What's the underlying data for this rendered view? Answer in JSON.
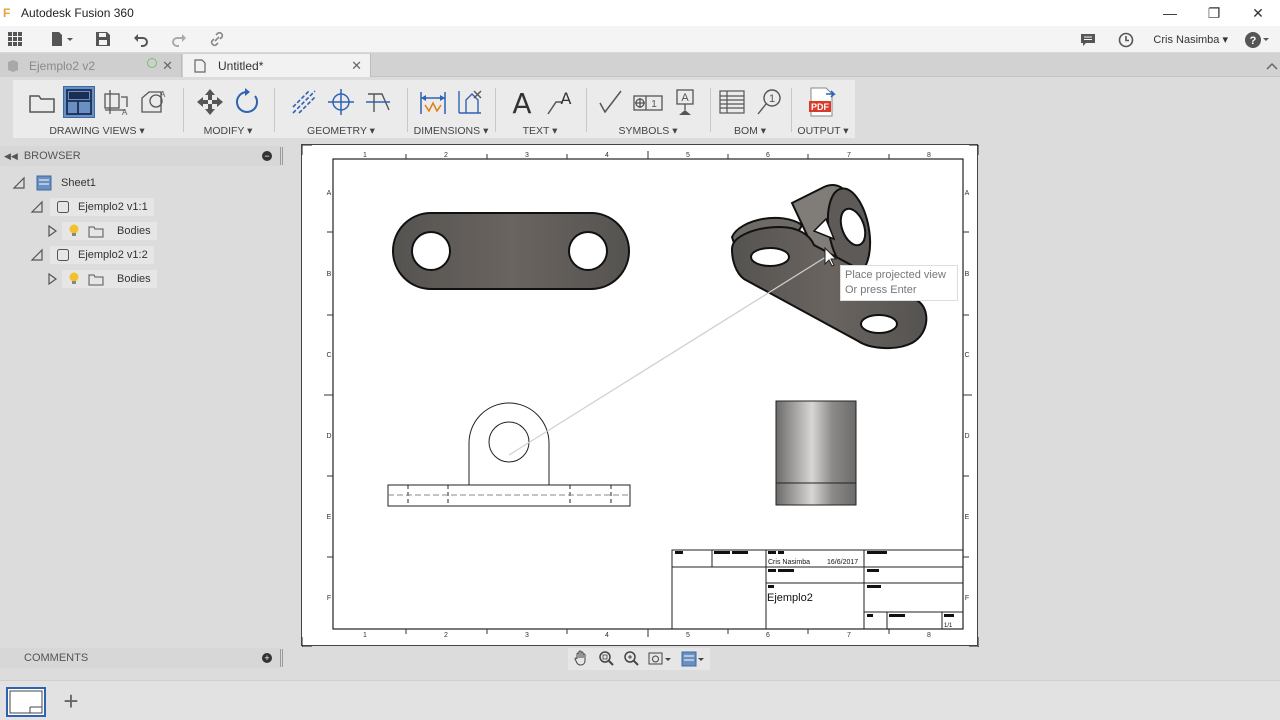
{
  "window": {
    "title": "Autodesk Fusion 360",
    "logo": "F"
  },
  "window_controls": {
    "minimize": "—",
    "restore": "❐",
    "close": "✕"
  },
  "user": {
    "name": "Cris Nasimba ▾"
  },
  "tabs": [
    {
      "label": "Ejemplo2 v2"
    },
    {
      "label": "Untitled*"
    }
  ],
  "ribbon": {
    "groups": [
      {
        "label": "DRAWING VIEWS ▾"
      },
      {
        "label": "MODIFY ▾"
      },
      {
        "label": "GEOMETRY ▾"
      },
      {
        "label": "DIMENSIONS ▾"
      },
      {
        "label": "TEXT ▾"
      },
      {
        "label": "SYMBOLS ▾"
      },
      {
        "label": "BOM ▾"
      },
      {
        "label": "OUTPUT ▾"
      }
    ],
    "pdf_label": "PDF"
  },
  "browser": {
    "header": "BROWSER",
    "items": [
      {
        "label": "Sheet1"
      },
      {
        "label": "Ejemplo2 v1:1"
      },
      {
        "label": "Bodies"
      },
      {
        "label": "Ejemplo2 v1:2"
      },
      {
        "label": "Bodies"
      }
    ]
  },
  "comments": {
    "header": "COMMENTS"
  },
  "tooltip": {
    "line1": "Place projected view",
    "line2": "Or press Enter"
  },
  "title_block": {
    "author": "Cris Nasimba",
    "date": "16/6/2017",
    "title": "Ejemplo2",
    "sheet": "1/1"
  },
  "border": {
    "columns": [
      "1",
      "2",
      "3",
      "4",
      "5",
      "6",
      "7",
      "8"
    ],
    "rows": [
      "A",
      "B",
      "C",
      "D",
      "E",
      "F"
    ]
  },
  "colors": {
    "accent": "#2e63b3",
    "active_tool": "#6a8fc1",
    "part_fill": "#5c5a57"
  }
}
